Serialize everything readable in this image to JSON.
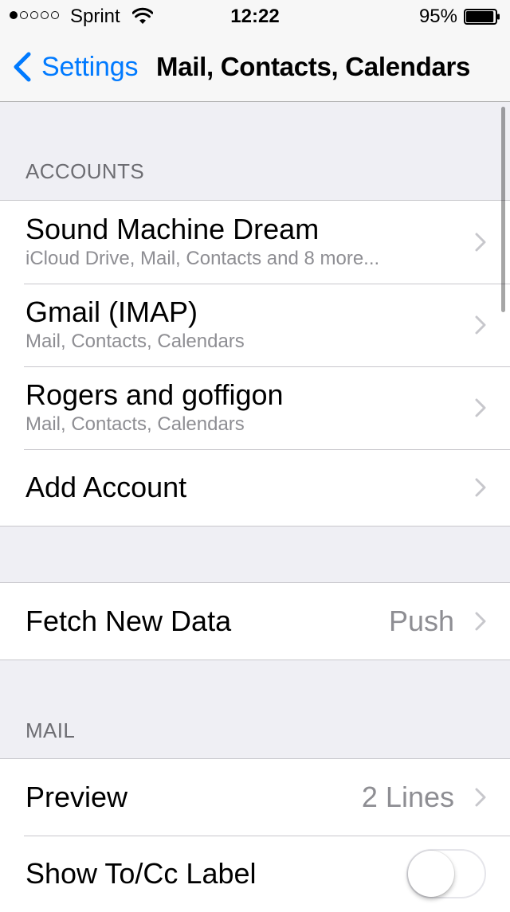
{
  "status_bar": {
    "carrier": "Sprint",
    "signal_bars_filled": 1,
    "signal_bars_total": 5,
    "time": "12:22",
    "battery_percent": "95%",
    "battery_level": 0.95
  },
  "nav": {
    "back_label": "Settings",
    "title": "Mail, Contacts, Calendars"
  },
  "sections": {
    "accounts_header": "ACCOUNTS",
    "mail_header": "MAIL"
  },
  "accounts": [
    {
      "title": "Sound Machine Dream",
      "subtitle": "iCloud Drive, Mail, Contacts and 8 more..."
    },
    {
      "title": "Gmail (IMAP)",
      "subtitle": "Mail, Contacts, Calendars"
    },
    {
      "title": "Rogers and goffigon",
      "subtitle": "Mail, Contacts, Calendars"
    }
  ],
  "add_account": {
    "label": "Add Account"
  },
  "fetch": {
    "label": "Fetch New Data",
    "value": "Push"
  },
  "mail_settings": {
    "preview_label": "Preview",
    "preview_value": "2 Lines",
    "show_tocc_label": "Show To/Cc Label",
    "show_tocc_on": false
  },
  "colors": {
    "accent": "#007aff",
    "background": "#efeff4",
    "secondary_text": "#8e8e93",
    "separator": "#c8c7cc"
  }
}
